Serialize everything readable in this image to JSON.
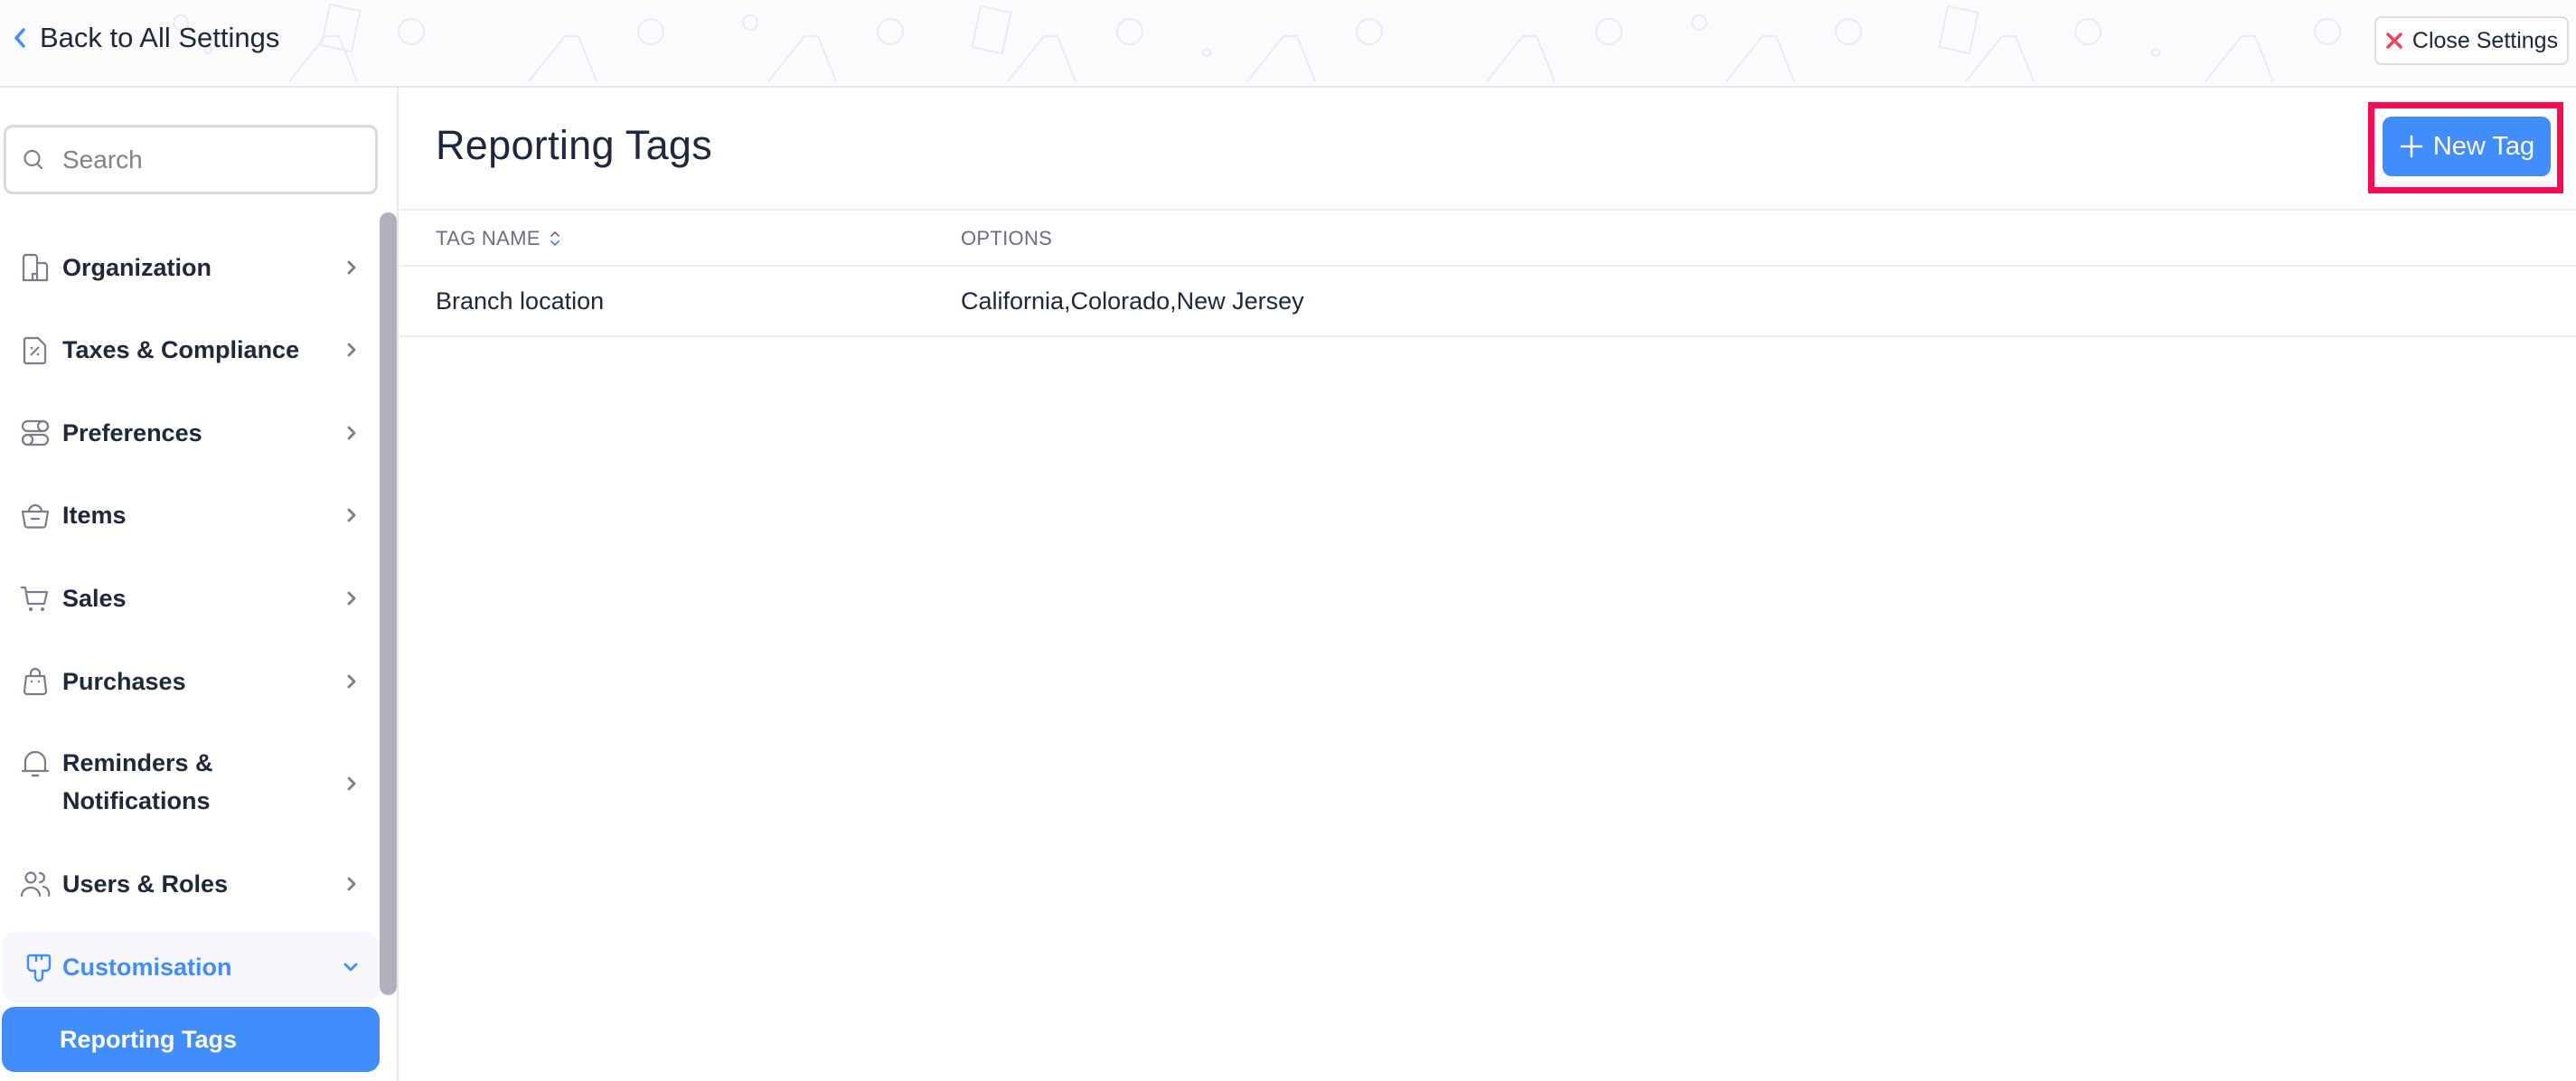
{
  "header": {
    "back_link_label": "Back to All Settings",
    "close_button_label": "Close Settings"
  },
  "sidebar": {
    "search": {
      "placeholder": "Search",
      "value": ""
    },
    "items": [
      {
        "label": "Organization",
        "icon": "building-icon",
        "expanded": false
      },
      {
        "label": "Taxes & Compliance",
        "icon": "tax-document-icon",
        "expanded": false
      },
      {
        "label": "Preferences",
        "icon": "toggles-icon",
        "expanded": false
      },
      {
        "label": "Items",
        "icon": "basket-icon",
        "expanded": false
      },
      {
        "label": "Sales",
        "icon": "cart-icon",
        "expanded": false
      },
      {
        "label": "Purchases",
        "icon": "shopping-bag-icon",
        "expanded": false
      },
      {
        "label": "Reminders & Notifications",
        "label_line1": "Reminders &",
        "label_line2": "Notifications",
        "icon": "bell-icon",
        "expanded": false
      },
      {
        "label": "Users & Roles",
        "icon": "users-icon",
        "expanded": false
      },
      {
        "label": "Customisation",
        "icon": "paint-brush-icon",
        "expanded": true
      }
    ],
    "sub_items": [
      {
        "label": "Reporting Tags",
        "active": true
      }
    ]
  },
  "main": {
    "title": "Reporting Tags",
    "new_tag_button_label": "New Tag",
    "table": {
      "columns": [
        {
          "label": "TAG NAME",
          "sortable": true
        },
        {
          "label": "OPTIONS",
          "sortable": false
        }
      ],
      "rows": [
        {
          "tag_name": "Branch location",
          "options": "California,Colorado,New Jersey"
        }
      ]
    }
  },
  "colors": {
    "accent": "#408dfb",
    "text_primary": "#21263c",
    "text_muted": "#6c6c80",
    "icon_muted": "#7b7b8c",
    "close_icon": "#f0405a",
    "highlight_box": "#ff0a52",
    "scrollbar": "#b1b1bd",
    "border": "#e6e6ee"
  }
}
